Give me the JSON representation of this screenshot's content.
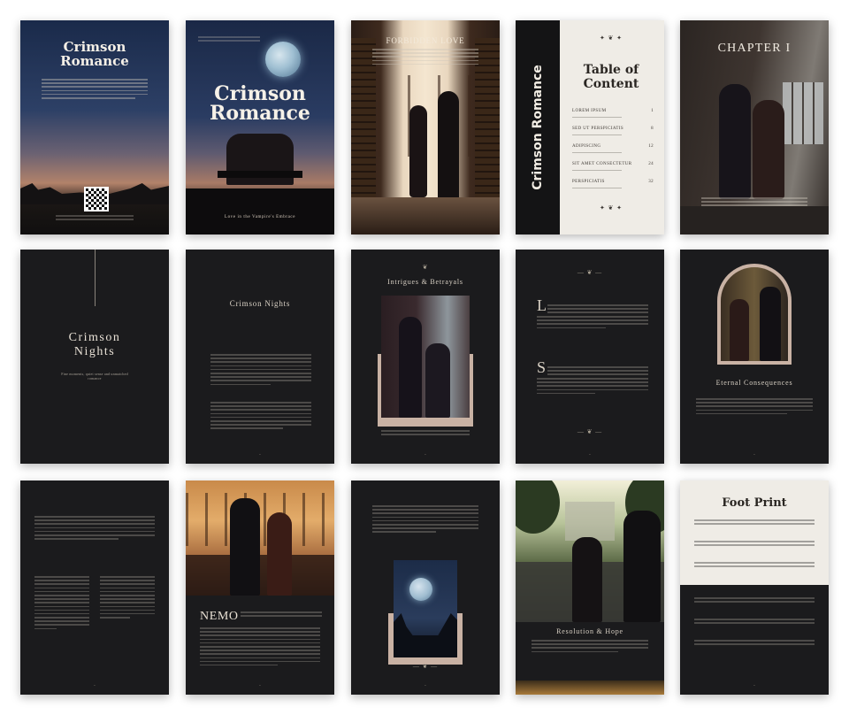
{
  "book": {
    "title_line1": "Crimson",
    "title_line2": "Romance",
    "spine_title": "Crimson Romance",
    "cover_tagline": "Love in the Vampire's Embrace"
  },
  "pages": {
    "p2_heading": "Forbidden Love",
    "toc_title_line1": "Table of",
    "toc_title_line2": "Content",
    "toc_entries": [
      {
        "label": "Lorem Ipsum",
        "num": "1"
      },
      {
        "label": "Sed ut perspiciatis",
        "num": "8"
      },
      {
        "label": "Adipiscing",
        "num": "12"
      },
      {
        "label": "Sit amet consectetur",
        "num": "24"
      },
      {
        "label": "Perspiciatis",
        "num": "32"
      }
    ],
    "chapter_heading": "CHAPTER I",
    "crimson_nights_line1": "Crimson",
    "crimson_nights_line2": "Nights",
    "crimson_nights_sub": "Fine moments, quiet sense and unmatched romance",
    "crimson_nights_heading": "Crimson Nights",
    "intrigues_heading": "Intrigues & Betrayals",
    "dropcap_l": "L",
    "dropcap_s": "S",
    "eternal_heading": "Eternal Consequences",
    "nemo_heading": "NEMO",
    "resolution_heading": "Resolution & Hope",
    "footprint_heading": "Foot Print"
  },
  "colors": {
    "page_dark": "#1b1b1d",
    "page_light": "#efece6",
    "accent_frame": "#c9b2a4",
    "night_sky": "#1d2d4c"
  },
  "icons": [
    "qr-code-icon",
    "moon-icon",
    "ornament-divider-icon"
  ]
}
